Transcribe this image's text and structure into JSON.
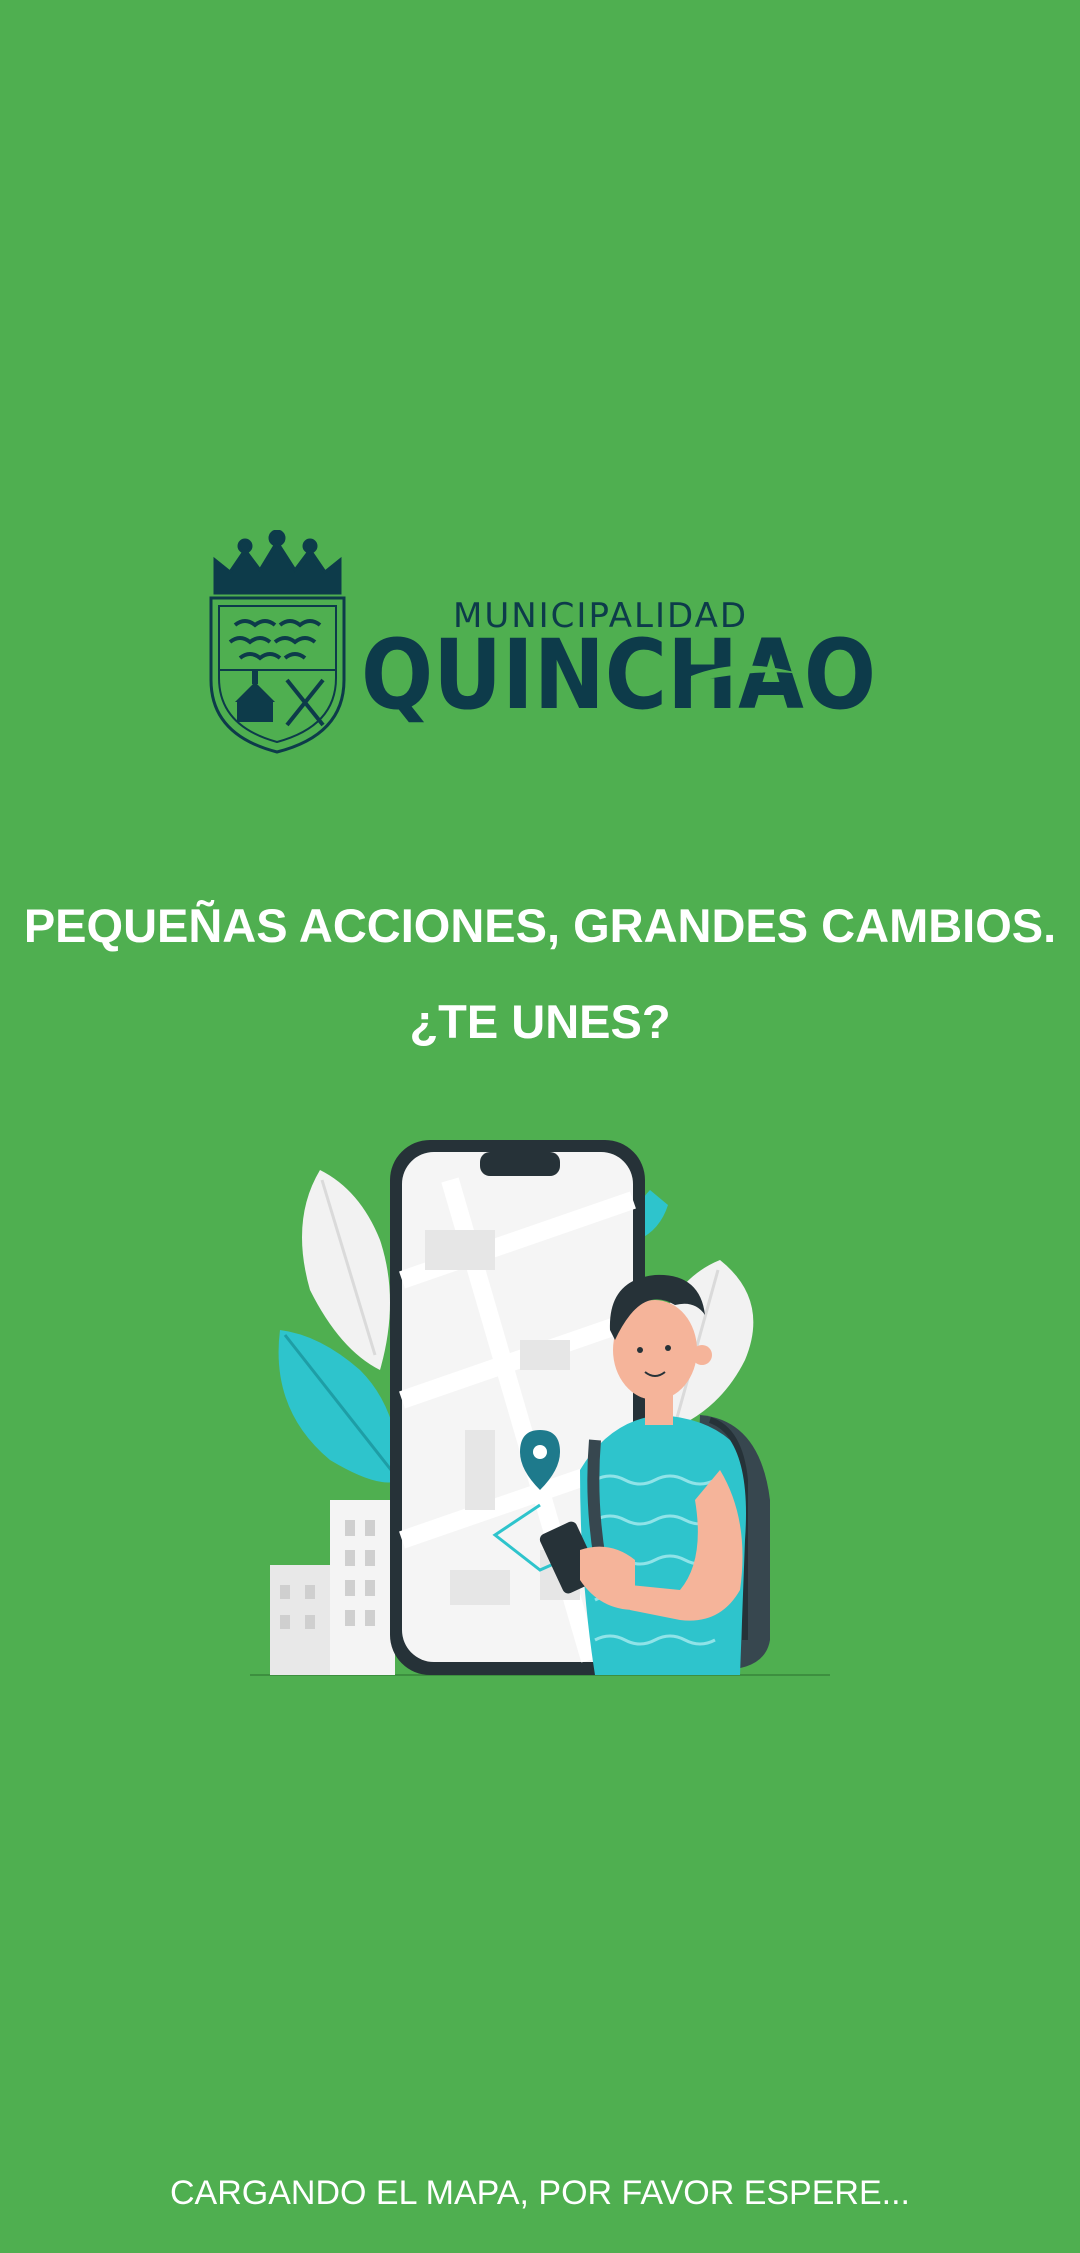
{
  "logo": {
    "subtitle": "MUNICIPALIDAD",
    "name": "QUINCHAO",
    "crest_icon": "coat-of-arms-icon",
    "color": "#0D3B4A"
  },
  "tagline": {
    "line1": "PEQUEÑAS ACCIONES, GRANDES CAMBIOS.",
    "line2": "¿TE UNES?"
  },
  "illustration": {
    "icon": "person-with-phone-map-illustration"
  },
  "status": {
    "loading_text": "CARGANDO EL MAPA, POR FAVOR ESPERE..."
  },
  "colors": {
    "background": "#4FAF50",
    "text": "#FFFFFF",
    "accent_teal": "#2EC4CC",
    "dark": "#263238"
  }
}
